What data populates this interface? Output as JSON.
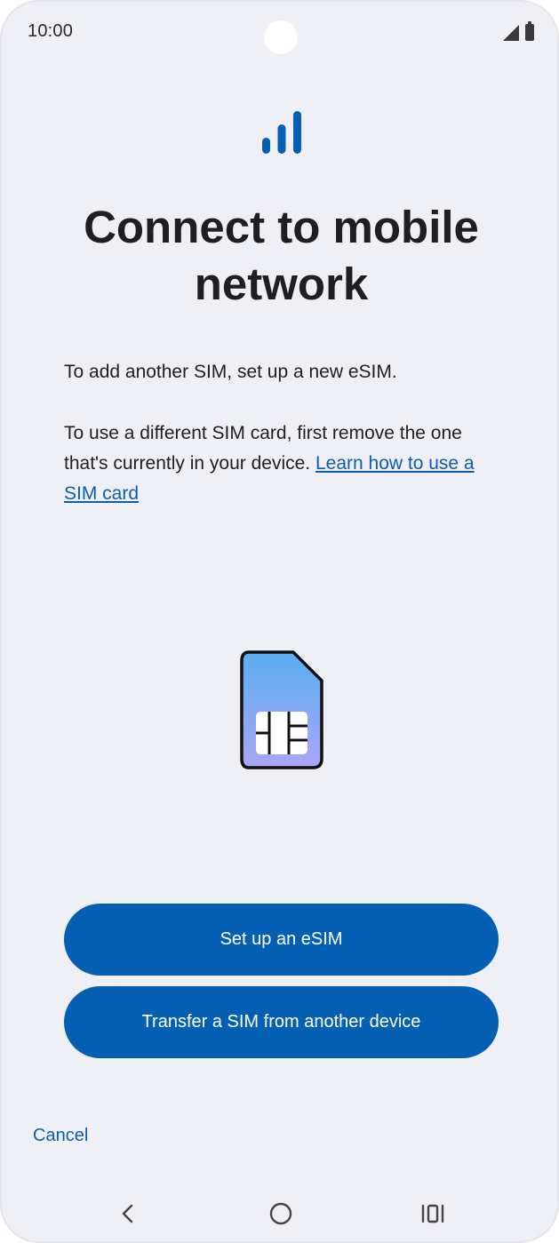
{
  "status_bar": {
    "time": "10:00",
    "icons": [
      "signal-icon",
      "battery-icon"
    ]
  },
  "header": {
    "icon": "cellular-signal-icon",
    "title": "Connect to mobile network"
  },
  "body": {
    "paragraph1": "To add another SIM, set up a new eSIM.",
    "paragraph2": "To use a different SIM card, first remove the one that's currently in your device.",
    "learn_link": "Learn how to use a SIM card"
  },
  "illustration": {
    "icon": "sim-card-icon"
  },
  "actions": {
    "setup_esim": "Set up an eSIM",
    "transfer_sim": "Transfer a SIM from another device",
    "cancel": "Cancel"
  },
  "nav": {
    "back": "back-icon",
    "home": "home-icon",
    "recents": "recents-icon"
  },
  "colors": {
    "accent": "#0560b4",
    "link": "#0b5eb0",
    "background": "#efeff6"
  }
}
